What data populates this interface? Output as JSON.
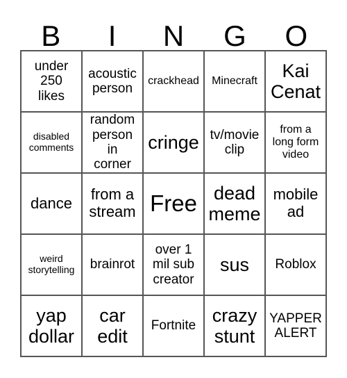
{
  "header": [
    "B",
    "I",
    "N",
    "G",
    "O"
  ],
  "cells": [
    "under 250 likes",
    "acoustic person",
    "crackhead",
    "Minecraft",
    "Kai Cenat",
    "disabled comments",
    "random person in corner",
    "cringe",
    "tv/movie clip",
    "from a long form video",
    "dance",
    "from a stream",
    "Free",
    "dead meme",
    "mobile ad",
    "weird storytelling",
    "brainrot",
    "over 1 mil sub creator",
    "sus",
    "Roblox",
    "yap dollar",
    "car edit",
    "Fortnite",
    "crazy stunt",
    "YAPPER ALERT"
  ]
}
